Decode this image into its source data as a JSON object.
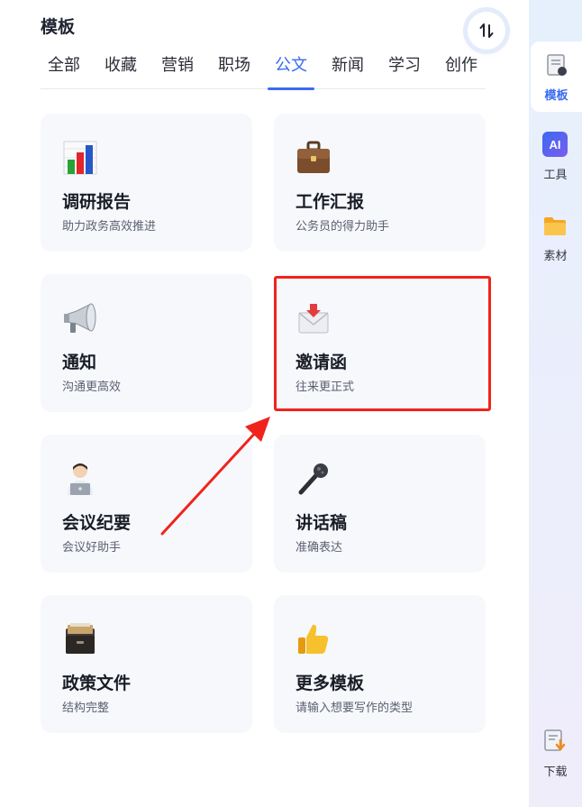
{
  "header": {
    "title": "模板",
    "sort_icon_text": "⇅"
  },
  "tabs": [
    {
      "label": "全部"
    },
    {
      "label": "收藏"
    },
    {
      "label": "营销"
    },
    {
      "label": "职场"
    },
    {
      "label": "公文",
      "active": true
    },
    {
      "label": "新闻"
    },
    {
      "label": "学习"
    },
    {
      "label": "创作"
    }
  ],
  "cards": [
    {
      "title": "调研报告",
      "subtitle": "助力政务高效推进",
      "icon": "bar-chart-icon"
    },
    {
      "title": "工作汇报",
      "subtitle": "公务员的得力助手",
      "icon": "briefcase-icon"
    },
    {
      "title": "通知",
      "subtitle": "沟通更高效",
      "icon": "megaphone-icon"
    },
    {
      "title": "邀请函",
      "subtitle": "往来更正式",
      "icon": "envelope-icon"
    },
    {
      "title": "会议纪要",
      "subtitle": "会议好助手",
      "icon": "laptop-person-icon"
    },
    {
      "title": "讲话稿",
      "subtitle": "准确表达",
      "icon": "microphone-icon"
    },
    {
      "title": "政策文件",
      "subtitle": "结构完整",
      "icon": "file-cabinet-icon"
    },
    {
      "title": "更多模板",
      "subtitle": "请输入想要写作的类型",
      "icon": "thumbs-up-icon"
    }
  ],
  "sidebar": {
    "items": [
      {
        "label": "模板",
        "icon": "template-icon",
        "active": true
      },
      {
        "label": "工具",
        "icon": "ai-icon",
        "icon_text": "AI"
      },
      {
        "label": "素材",
        "icon": "folder-icon"
      },
      {
        "label": "下载",
        "icon": "download-icon"
      }
    ]
  },
  "colors": {
    "accent": "#3a6af0",
    "highlight": "#f0231c",
    "card_bg": "#f6f8fc"
  }
}
